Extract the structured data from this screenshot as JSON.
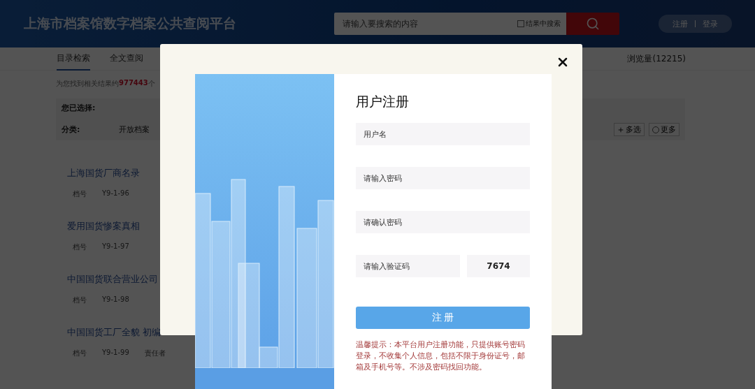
{
  "header": {
    "title": "上海市档案馆数字档案公共查阅平台",
    "search": {
      "placeholder": "请输入要搜索的内容",
      "in_results": {
        "label": "结果中搜索",
        "checked": false
      }
    },
    "auth": [
      "注册",
      "登录"
    ]
  },
  "nav": {
    "tabs": [
      {
        "label": "目录检索",
        "selected": true
      },
      {
        "label": "全文查阅",
        "selected": false
      }
    ],
    "views": "浏览量(12215)"
  },
  "summary": {
    "prefix": "为您找到相关结果约",
    "count": "977443",
    "suffix": "个"
  },
  "filters": {
    "heading": "您已选择:",
    "category_label": "分类:",
    "category_value": "开放档案",
    "buttons": [
      {
        "label": "多选",
        "kind": "plus"
      },
      {
        "label": "更多",
        "kind": "more"
      }
    ]
  },
  "results": [
    {
      "title": "上海国货厂商名录",
      "fields": [
        {
          "label": "档号",
          "value": "Y9-1-96"
        }
      ]
    },
    {
      "title": "爱用国货惨案真相",
      "fields": [
        {
          "label": "档号",
          "value": "Y9-1-97"
        }
      ]
    },
    {
      "title": "中国国货联合营业公司",
      "fields": [
        {
          "label": "档号",
          "value": "Y9-1-98"
        }
      ]
    },
    {
      "title": "中国国货工厂全貌 初编",
      "fields": [
        {
          "label": "档号",
          "value": "Y9-1-99"
        },
        {
          "label": "责任者"
        }
      ]
    }
  ],
  "modal": {
    "title": "用户注册",
    "fields": [
      {
        "placeholder": "用户名"
      },
      {
        "placeholder": "请输入密码"
      },
      {
        "placeholder": "请确认密码"
      }
    ],
    "captcha": {
      "placeholder": "请输入验证码",
      "code": "7674"
    },
    "submit": "注 册",
    "notice": "温馨提示：本平台用户注册功能，只提供账号密码登录，不收集个人信息，包括不限于身份证号，邮箱及手机号等。不涉及密码找回功能。"
  }
}
